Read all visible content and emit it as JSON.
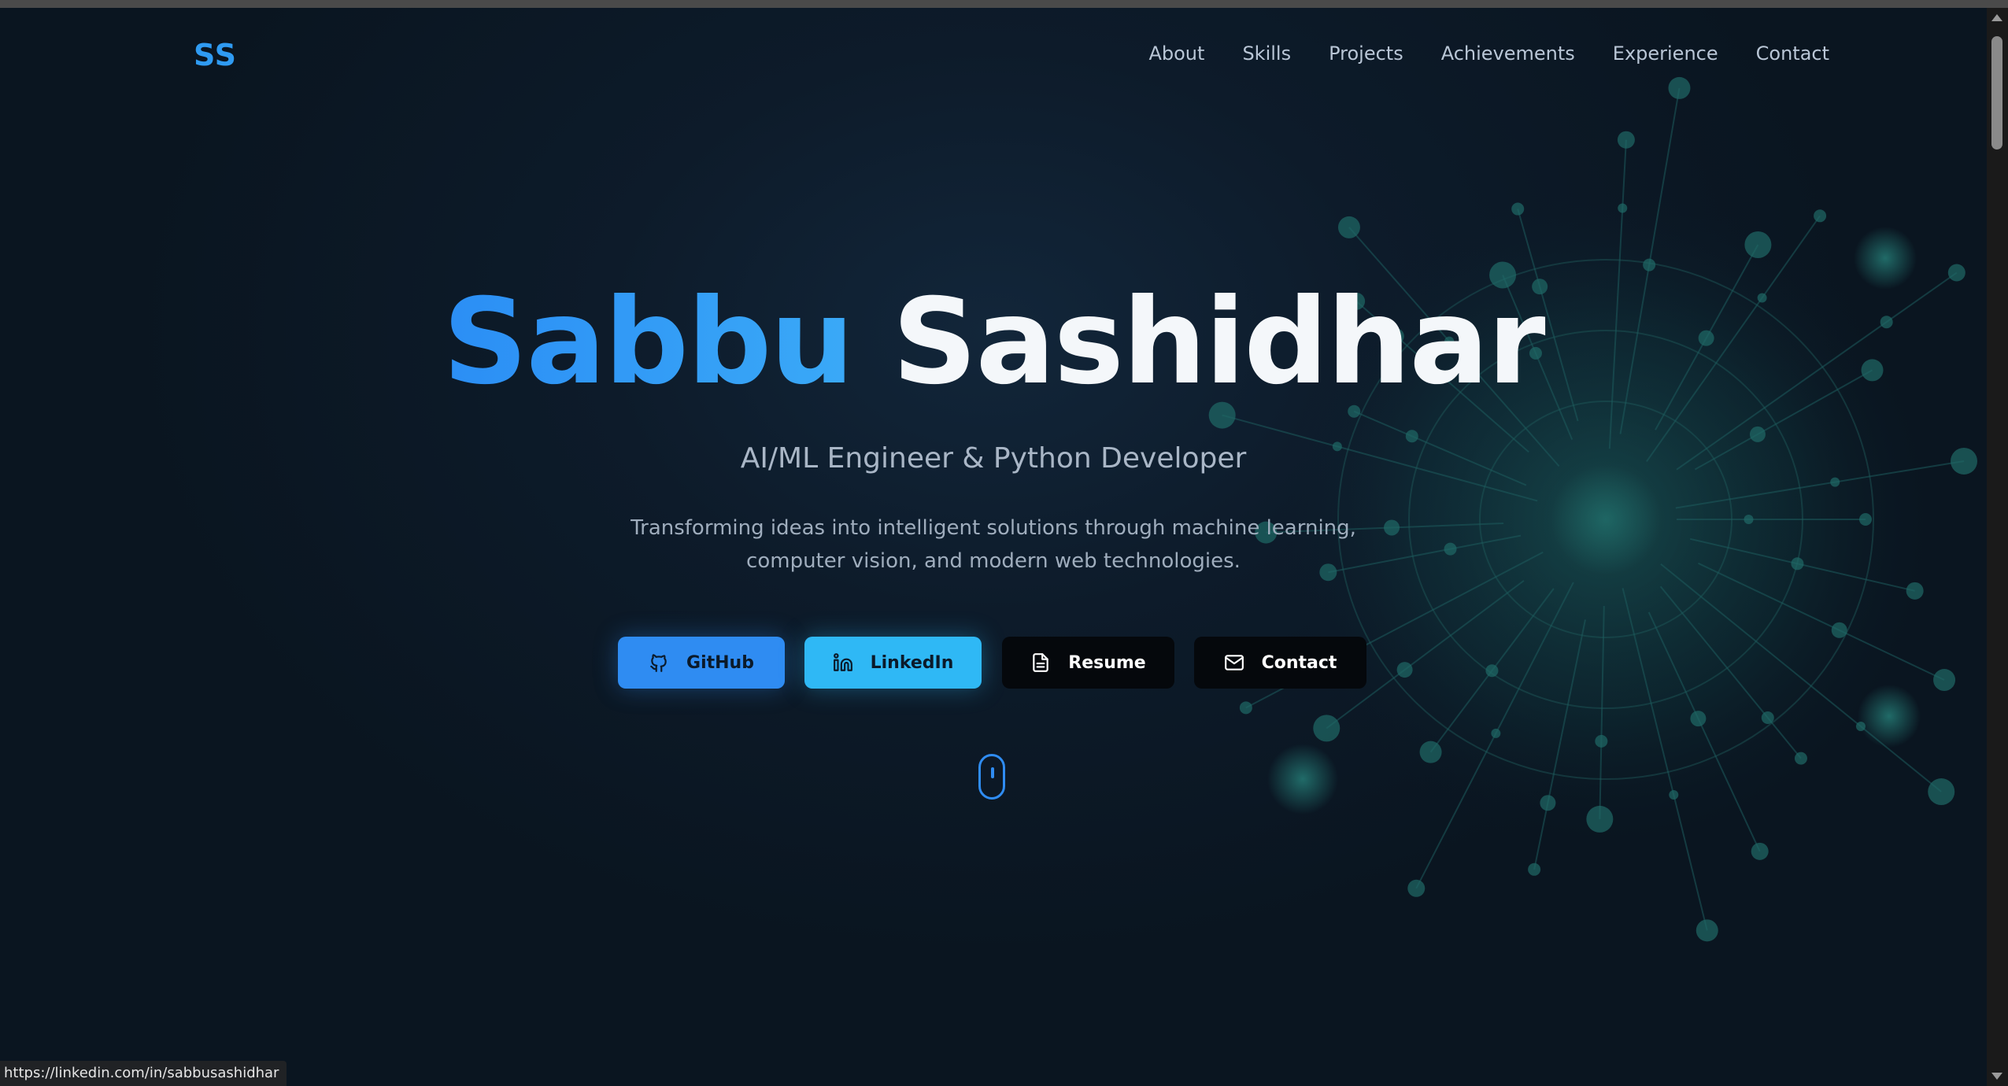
{
  "nav": {
    "logo": "SS",
    "items": [
      "About",
      "Skills",
      "Projects",
      "Achievements",
      "Experience",
      "Contact"
    ]
  },
  "hero": {
    "first_name": "Sabbu",
    "last_name": "Sashidhar",
    "subtitle": "AI/ML Engineer & Python Developer",
    "description": "Transforming ideas into intelligent solutions through machine learning, computer vision, and modern web technologies."
  },
  "buttons": {
    "github": "GitHub",
    "linkedin": "LinkedIn",
    "resume": "Resume",
    "contact": "Contact"
  },
  "status_bar": {
    "url": "https://linkedin.com/in/sabbusashidhar"
  },
  "colors": {
    "accent": "#2f8cf2",
    "accent_light": "#2fb8f5",
    "background": "#0d1b2a",
    "text": "#f4f7fa",
    "muted_text": "#a9b6c6"
  },
  "icons": {
    "github": "github-icon",
    "linkedin": "linkedin-icon",
    "resume": "document-icon",
    "contact": "mail-icon",
    "scroll": "mouse-scroll-icon"
  }
}
